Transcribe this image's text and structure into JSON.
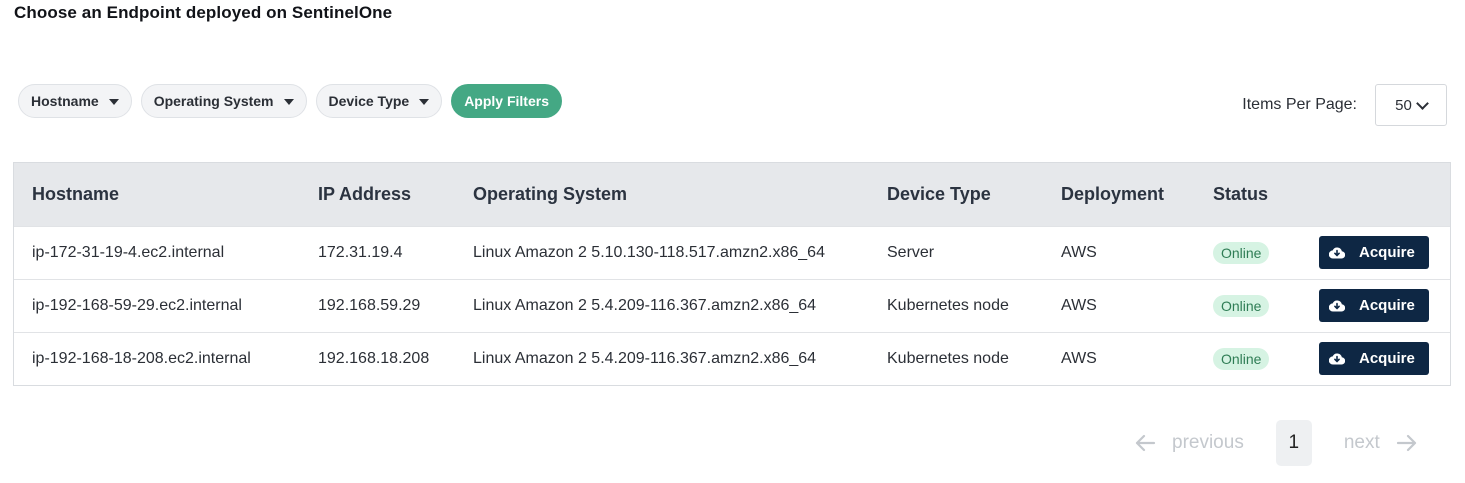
{
  "page": {
    "title": "Choose an Endpoint deployed on SentinelOne"
  },
  "filters": {
    "hostname_label": "Hostname",
    "os_label": "Operating System",
    "device_type_label": "Device Type",
    "apply_label": "Apply Filters"
  },
  "pagination_size": {
    "label": "Items Per Page:",
    "value": "50"
  },
  "table": {
    "columns": [
      "Hostname",
      "IP Address",
      "Operating System",
      "Device Type",
      "Deployment",
      "Status"
    ],
    "action_label": "Acquire",
    "rows": [
      {
        "hostname": "ip-172-31-19-4.ec2.internal",
        "ip": "172.31.19.4",
        "os": "Linux Amazon 2 5.10.130-118.517.amzn2.x86_64",
        "device_type": "Server",
        "deployment": "AWS",
        "status": "Online"
      },
      {
        "hostname": "ip-192-168-59-29.ec2.internal",
        "ip": "192.168.59.29",
        "os": "Linux Amazon 2 5.4.209-116.367.amzn2.x86_64",
        "device_type": "Kubernetes node",
        "deployment": "AWS",
        "status": "Online"
      },
      {
        "hostname": "ip-192-168-18-208.ec2.internal",
        "ip": "192.168.18.208",
        "os": "Linux Amazon 2 5.4.209-116.367.amzn2.x86_64",
        "device_type": "Kubernetes node",
        "deployment": "AWS",
        "status": "Online"
      }
    ]
  },
  "pager": {
    "previous": "previous",
    "current_page": "1",
    "next": "next"
  },
  "colors": {
    "accent": "#44a884",
    "primary_button": "#0e2744",
    "status_online_bg": "#d6f3e3",
    "header_bg": "#e6e8eb"
  },
  "icons": {
    "action": "cloud-download-icon",
    "filter_caret": "caret-down-icon",
    "prev": "arrow-left-icon",
    "next": "arrow-right-icon"
  }
}
